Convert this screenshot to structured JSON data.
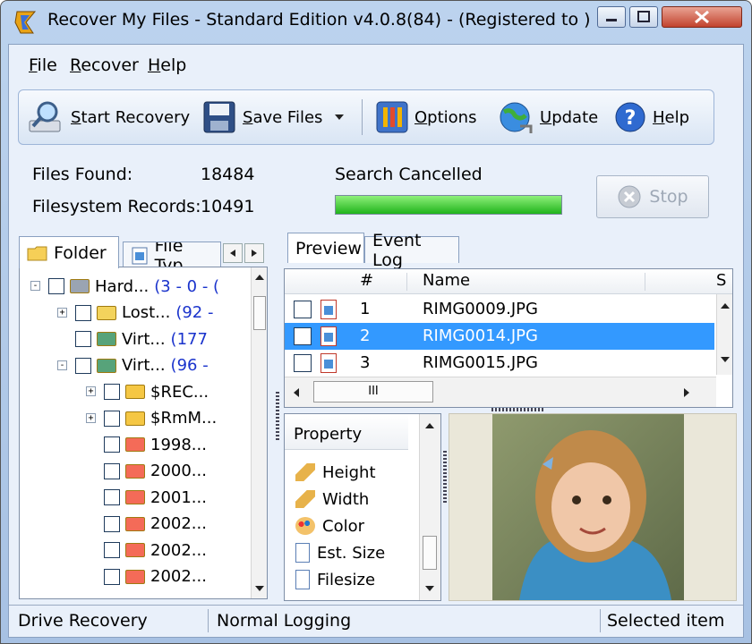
{
  "window": {
    "title": "Recover My Files - Standard Edition v4.0.8(84)  -  (Registered to )"
  },
  "menu": {
    "file": {
      "accel": "F",
      "rest": "ile"
    },
    "recover": {
      "accel": "R",
      "rest": "ecover"
    },
    "help": {
      "accel": "H",
      "rest": "elp"
    }
  },
  "toolbar": {
    "start_recovery": {
      "accel": "S",
      "rest": "tart Recovery"
    },
    "save_files": {
      "accel": "S",
      "rest": "ave Files"
    },
    "options": {
      "accel": "O",
      "rest": "ptions"
    },
    "update": {
      "accel": "U",
      "rest": "pdate"
    },
    "help": {
      "accel": "H",
      "rest": "elp"
    }
  },
  "stats": {
    "files_found_label": "Files Found:",
    "files_found_value": "18484",
    "fs_records_label": "Filesystem Records:",
    "fs_records_value": "10491",
    "search_status": "Search Cancelled",
    "progress_fraction": 1.0,
    "stop_label": "Stop"
  },
  "left_tabs": {
    "folder": "Folder",
    "file_type": "File Typ"
  },
  "tree": [
    {
      "label": "Hard...",
      "extra": "(3 - 0 - (",
      "icon": "drive-icon"
    },
    {
      "label": "Lost...",
      "extra": "(92 -",
      "icon": "lost-files-icon"
    },
    {
      "label": "Virt...",
      "extra": "(177",
      "icon": "virtual-folder-icon"
    },
    {
      "label": "Virt...",
      "extra": "(96 -",
      "icon": "virtual-folder-icon"
    },
    {
      "label": "$REC...",
      "extra": "",
      "icon": "folder-icon"
    },
    {
      "label": "$RmM...",
      "extra": "",
      "icon": "folder-icon"
    },
    {
      "label": "1998...",
      "extra": "",
      "icon": "folder-icon"
    },
    {
      "label": "2000...",
      "extra": "",
      "icon": "folder-icon"
    },
    {
      "label": "2001...",
      "extra": "",
      "icon": "folder-icon"
    },
    {
      "label": "2002...",
      "extra": "",
      "icon": "folder-icon"
    },
    {
      "label": "2002...",
      "extra": "",
      "icon": "folder-icon"
    },
    {
      "label": "2002...",
      "extra": "",
      "icon": "folder-icon"
    }
  ],
  "right_tabs": {
    "preview": "Preview",
    "event_log": "Event Log"
  },
  "file_list": {
    "columns": {
      "num": "#",
      "name": "Name",
      "size": "S"
    },
    "rows": [
      {
        "num": "1",
        "name": "RIMG0009.JPG",
        "selected": false
      },
      {
        "num": "2",
        "name": "RIMG0014.JPG",
        "selected": true
      },
      {
        "num": "3",
        "name": "RIMG0015.JPG",
        "selected": false
      }
    ],
    "hscroll_grip": "III"
  },
  "properties": {
    "header": "Property",
    "items": [
      {
        "label": "Height",
        "icon": "ruler-icon"
      },
      {
        "label": "Width",
        "icon": "ruler-icon"
      },
      {
        "label": "Color",
        "icon": "palette-icon"
      },
      {
        "label": "Est. Size",
        "icon": "page-icon"
      },
      {
        "label": "Filesize",
        "icon": "page-icon"
      }
    ]
  },
  "statusbar": {
    "mode": "Drive Recovery",
    "logging": "Normal Logging",
    "selection": "Selected item"
  },
  "colors": {
    "selection": "#3399ff",
    "progress": "#20b31c",
    "link_blue": "#1a33cc"
  }
}
